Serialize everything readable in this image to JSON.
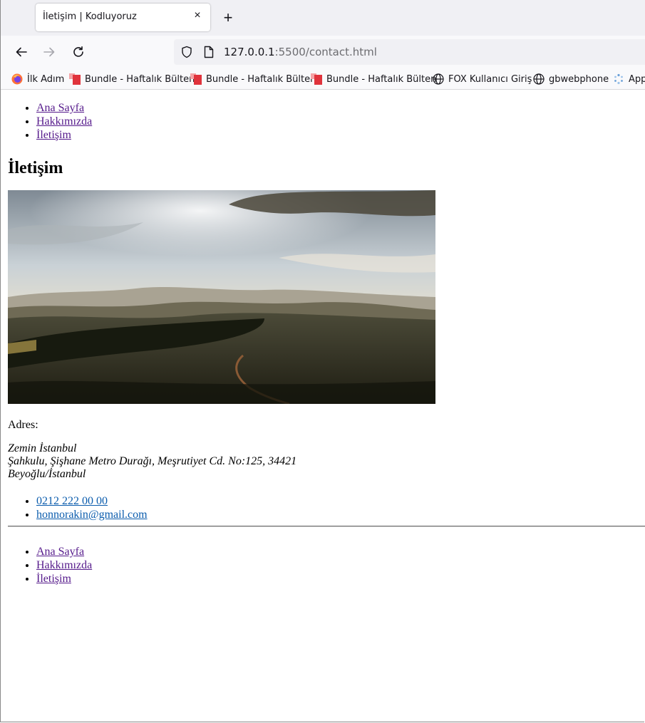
{
  "browser": {
    "tab_title": "İletişim | Kodluyoruz",
    "tab_close": "×",
    "new_tab": "+",
    "url_host": "127.0.0.1",
    "url_rest": ":5500/contact.html"
  },
  "bookmarks": [
    {
      "label": "İlk Adım",
      "icon": "firefox-icon"
    },
    {
      "label": "Bundle - Haftalık Bülten",
      "icon": "bundle-icon"
    },
    {
      "label": "Bundle - Haftalık Bülten",
      "icon": "bundle-icon"
    },
    {
      "label": "Bundle - Haftalık Bülten",
      "icon": "bundle-icon"
    },
    {
      "label": "FOX Kullanıcı Giriş",
      "icon": "globe-icon"
    },
    {
      "label": "gbwebphone",
      "icon": "globe-icon"
    },
    {
      "label": "App",
      "icon": "apps-icon"
    }
  ],
  "page": {
    "nav": [
      "Ana Sayfa",
      "Hakkımızda",
      "İletişim"
    ],
    "heading": "İletişim",
    "address_label": "Adres:",
    "address_lines": [
      "Zemin İstanbul",
      "Şahkulu, Şişhane Metro Durağı, Meşrutiyet Cd. No:125, 34421",
      "Beyoğlu/İstanbul"
    ],
    "contacts": [
      "0212 222 00 00",
      "honnorakin@gmail.com"
    ],
    "footer_nav": [
      "Ana Sayfa",
      "Hakkımızda",
      "İletişim"
    ]
  },
  "colors": {
    "visited_link": "#551a8b",
    "contact_link": "#0b5cad",
    "bundle_red": "#e0333c"
  }
}
